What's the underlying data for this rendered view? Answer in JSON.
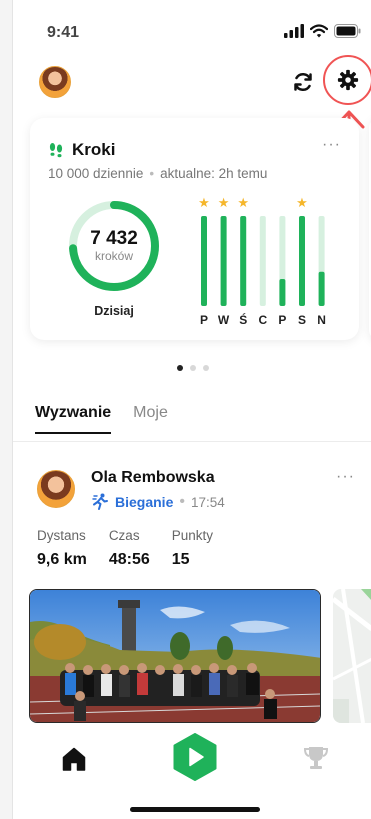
{
  "status_bar": {
    "time": "9:41"
  },
  "steps_card": {
    "title": "Kroki",
    "daily_goal": "10 000 dziennie",
    "updated": "aktualne: 2h temu",
    "menu": "···",
    "today_value": "7 432",
    "today_unit": "kroków",
    "today_label": "Dzisiaj",
    "today_progress": 0.74,
    "week": [
      {
        "day": "P",
        "progress": 1.0,
        "goal_reached": true
      },
      {
        "day": "W",
        "progress": 1.0,
        "goal_reached": true
      },
      {
        "day": "Ś",
        "progress": 1.0,
        "goal_reached": true
      },
      {
        "day": "C",
        "progress": 0.0,
        "goal_reached": false
      },
      {
        "day": "P",
        "progress": 0.3,
        "goal_reached": false
      },
      {
        "day": "S",
        "progress": 1.0,
        "goal_reached": true
      },
      {
        "day": "N",
        "progress": 0.38,
        "goal_reached": false
      }
    ]
  },
  "pager": {
    "count": 3,
    "active": 0
  },
  "tabs": [
    {
      "label": "Wyzwanie",
      "active": true
    },
    {
      "label": "Moje",
      "active": false
    }
  ],
  "post": {
    "author": "Ola Rembowska",
    "activity": "Bieganie",
    "time": "17:54",
    "menu": "···",
    "stats": [
      {
        "label": "Dystans",
        "value": "9,6 km"
      },
      {
        "label": "Czas",
        "value": "48:56"
      },
      {
        "label": "Punkty",
        "value": "15"
      }
    ]
  },
  "colors": {
    "accent_green": "#1fb25a",
    "light_green": "#d6f0df",
    "star": "#f5b62b",
    "link_blue": "#2b6fd8",
    "annotation_red": "#f05454"
  },
  "icons": {
    "refresh": "refresh-icon",
    "settings": "gear-icon",
    "home": "home-icon",
    "play": "play-icon",
    "trophy": "trophy-icon"
  }
}
